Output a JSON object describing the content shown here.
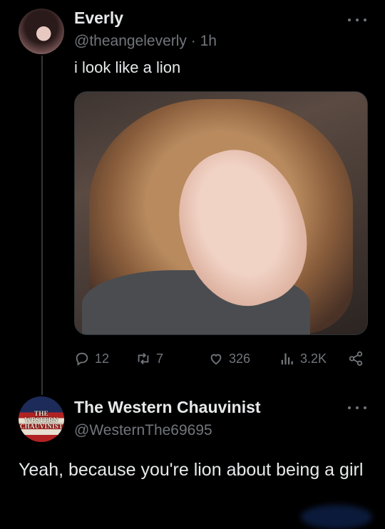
{
  "tweet": {
    "author_name": "Everly",
    "author_handle": "@theangeleverly · 1h",
    "text": "i look like a lion",
    "stats": {
      "replies": "12",
      "retweets": "7",
      "likes": "326",
      "views": "3.2K"
    }
  },
  "reply": {
    "author_name": "The Western Chauvinist",
    "author_handle": "@WesternThe69695",
    "text": "Yeah, because you're lion about being a girl",
    "avatar_text": "THE WESTERN CHAUVINIST"
  },
  "icons": {
    "reply": "reply-icon",
    "retweet": "retweet-icon",
    "like": "heart-icon",
    "views": "views-icon",
    "share": "share-icon",
    "more": "more-icon"
  },
  "colors": {
    "background": "#000000",
    "text": "#e7e9ea",
    "secondary": "#71767b"
  }
}
